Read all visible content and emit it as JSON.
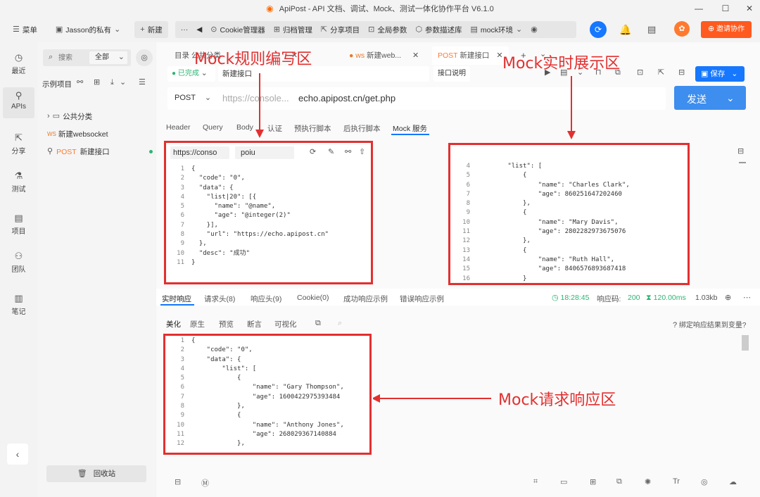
{
  "window": {
    "title": "ApiPost - API 文档、调试、Mock、测试一体化协作平台 V6.1.0",
    "min": "—",
    "max": "☐",
    "close": "✕"
  },
  "toolbar": {
    "menu": "菜单",
    "workspace": "Jasson的私有",
    "new": "新建",
    "more": "···",
    "back": "◀",
    "items": [
      "Cookie管理器",
      "归档管理",
      "分享项目",
      "全局参数",
      "参数描述库",
      "mock环境"
    ],
    "invite": "邀请协作",
    "colors": {
      "primary": "#1677ff",
      "invite": "#ff5a1f"
    }
  },
  "leftnav": [
    {
      "label": "最近",
      "icon": "clock-icon"
    },
    {
      "label": "APIs",
      "icon": "api-icon"
    },
    {
      "label": "分享",
      "icon": "share-icon"
    },
    {
      "label": "测试",
      "icon": "test-icon"
    },
    {
      "label": "项目",
      "icon": "project-icon"
    },
    {
      "label": "团队",
      "icon": "team-icon"
    },
    {
      "label": "笔记",
      "icon": "note-icon"
    }
  ],
  "tree": {
    "search_placeholder": "搜索",
    "filter": "全部",
    "project": "示例项目",
    "items": [
      {
        "label": "公共分类",
        "prefix": ""
      },
      {
        "label": "新建websocket",
        "prefix": "WS"
      },
      {
        "label": "新建接口",
        "prefix": "POST"
      }
    ],
    "recycle": "回收站"
  },
  "tabs": [
    {
      "label": "目录 公共分类"
    },
    {
      "label": "新建web..."
    },
    {
      "label": "新建接口",
      "prefix": "POST"
    }
  ],
  "request": {
    "status": "已完成",
    "name": "新建接口",
    "doc_button": "接口说明",
    "save": "保存",
    "method": "POST",
    "url_prefix": "https://console...",
    "url": "echo.apipost.cn/get.php",
    "send": "发送"
  },
  "req_tabs": [
    "Header",
    "Query",
    "Body",
    "认证",
    "预执行脚本",
    "后执行脚本",
    "Mock 服务"
  ],
  "mock_editor": {
    "url_prefix": "https://conso",
    "path": "poiu",
    "lines": [
      {
        "n": "1",
        "t": "{"
      },
      {
        "n": "2",
        "t": "  \"code\": \"0\","
      },
      {
        "n": "3",
        "t": "  \"data\": {"
      },
      {
        "n": "4",
        "t": "    \"list|20\": [{"
      },
      {
        "n": "5",
        "t": "      \"name\": \"@name\","
      },
      {
        "n": "6",
        "t": "      \"age\": \"@integer(2)\""
      },
      {
        "n": "7",
        "t": "    }],"
      },
      {
        "n": "8",
        "t": "    \"url\": \"https://echo.apipost.cn\""
      },
      {
        "n": "9",
        "t": "  },"
      },
      {
        "n": "10",
        "t": "  \"desc\": \"成功\""
      },
      {
        "n": "11",
        "t": "}"
      }
    ]
  },
  "mock_preview": {
    "lines": [
      {
        "n": "4",
        "t": "        \"list\": ["
      },
      {
        "n": "5",
        "t": "            {"
      },
      {
        "n": "6",
        "t": "                \"name\": \"Charles Clark\","
      },
      {
        "n": "7",
        "t": "                \"age\": 860251647202460"
      },
      {
        "n": "8",
        "t": "            },"
      },
      {
        "n": "9",
        "t": "            {"
      },
      {
        "n": "10",
        "t": "                \"name\": \"Mary Davis\","
      },
      {
        "n": "11",
        "t": "                \"age\": 2802282973675076"
      },
      {
        "n": "12",
        "t": "            },"
      },
      {
        "n": "13",
        "t": "            {"
      },
      {
        "n": "14",
        "t": "                \"name\": \"Ruth Hall\","
      },
      {
        "n": "15",
        "t": "                \"age\": 8406576893687418"
      },
      {
        "n": "16",
        "t": "            }"
      }
    ]
  },
  "resp_tabs": [
    "实时响应",
    "请求头(8)",
    "响应头(9)",
    "Cookie(0)",
    "成功响应示例",
    "错误响应示例"
  ],
  "resp_stats": {
    "time": "18:28:45",
    "code_label": "响应码:",
    "code": "200",
    "duration": "120.00ms",
    "size": "1.03kb"
  },
  "resp_subtabs": [
    "美化",
    "原生",
    "预览",
    "断言",
    "可视化"
  ],
  "bind_var": "绑定响应结果到变量?",
  "response": {
    "lines": [
      {
        "n": "1",
        "t": "{"
      },
      {
        "n": "2",
        "t": "    \"code\": \"0\","
      },
      {
        "n": "3",
        "t": "    \"data\": {"
      },
      {
        "n": "4",
        "t": "        \"list\": ["
      },
      {
        "n": "5",
        "t": "            {"
      },
      {
        "n": "6",
        "t": "                \"name\": \"Gary Thompson\","
      },
      {
        "n": "7",
        "t": "                \"age\": 1600422975393484"
      },
      {
        "n": "8",
        "t": "            },"
      },
      {
        "n": "9",
        "t": "            {"
      },
      {
        "n": "10",
        "t": "                \"name\": \"Anthony Jones\","
      },
      {
        "n": "11",
        "t": "                \"age\": 268029367140884"
      },
      {
        "n": "12",
        "t": "            },"
      }
    ]
  },
  "annotations": {
    "rule": "Mock规则编写区",
    "preview": "Mock实时展示区",
    "response": "Mock请求响应区",
    "color": "#e23030"
  }
}
